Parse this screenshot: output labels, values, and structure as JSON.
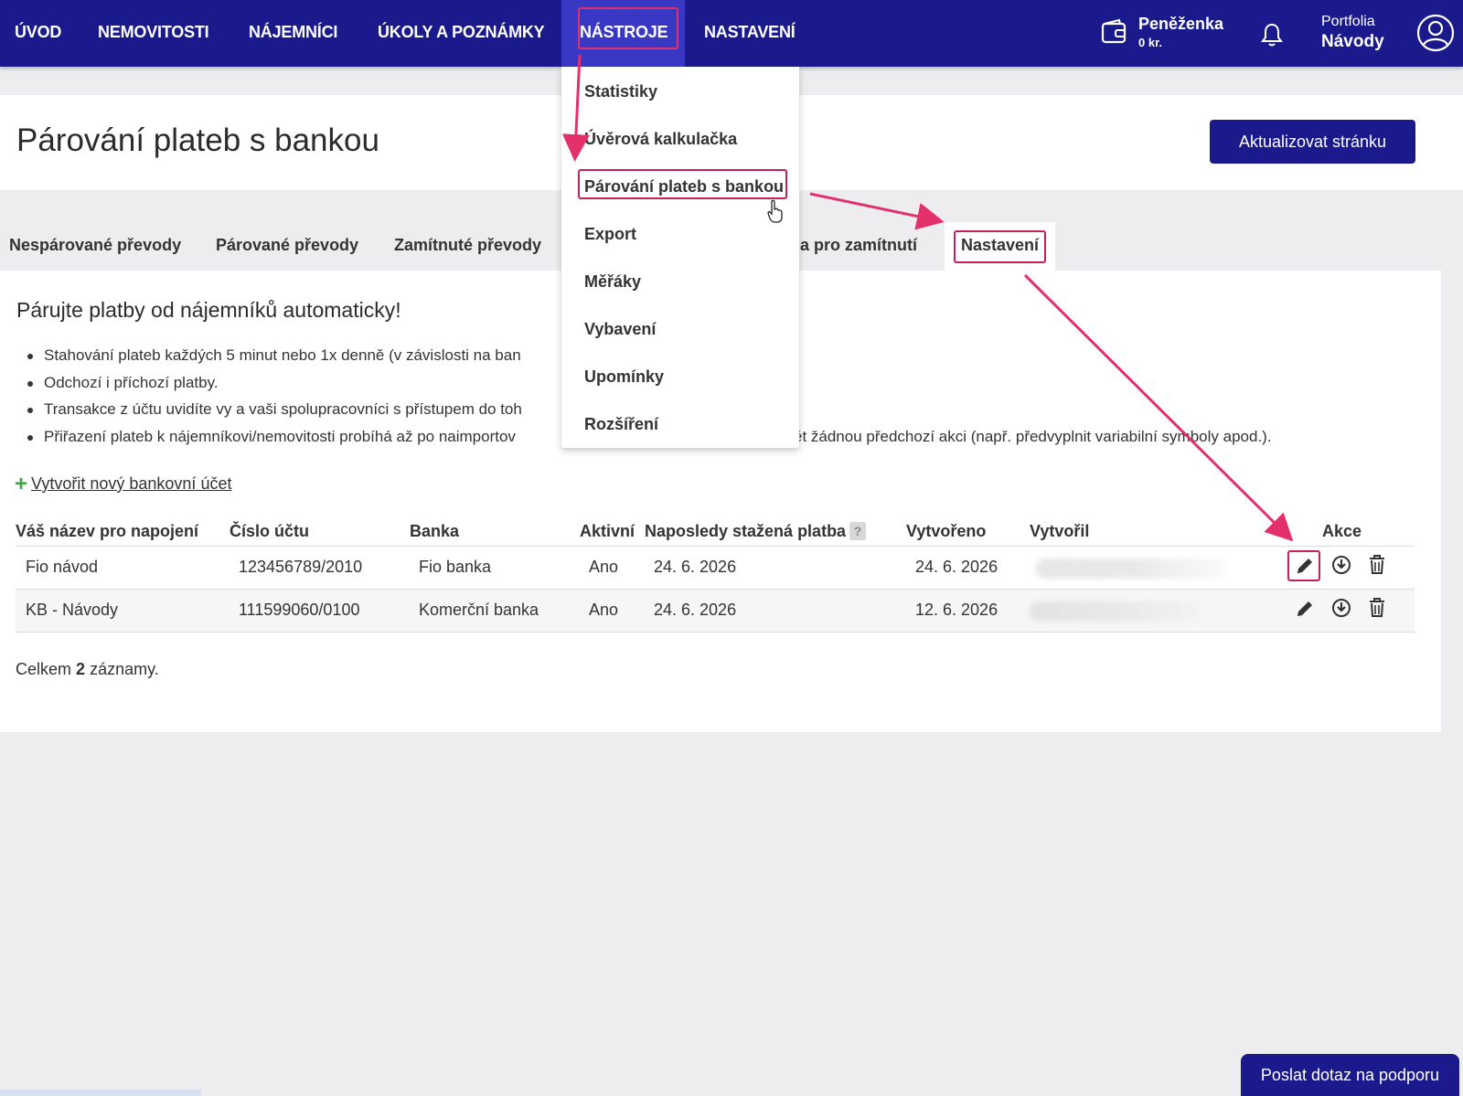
{
  "nav": {
    "items": [
      "ÚVOD",
      "NEMOVITOSTI",
      "NÁJEMNÍCI",
      "ÚKOLY A POZNÁMKY",
      "NÁSTROJE",
      "NASTAVENÍ"
    ],
    "active": "NÁSTROJE",
    "wallet": {
      "title": "Peněženka",
      "value": "0 kr.",
      "icon": "wallet-icon"
    },
    "notifications_icon": "bell-icon",
    "portfolio": {
      "label": "Portfolia",
      "value": "Návody"
    },
    "user_icon": "user-avatar-icon"
  },
  "dropdown": {
    "items": [
      "Statistiky",
      "Úvěrová kalkulačka",
      "Párování plateb s bankou",
      "Export",
      "Měřáky",
      "Vybavení",
      "Upomínky",
      "Rozšíření"
    ],
    "highlighted": "Párování plateb s bankou"
  },
  "header": {
    "title": "Párování plateb s bankou",
    "refresh_button": "Aktualizovat stránku"
  },
  "tabs": {
    "items": [
      "Nespárované převody",
      "Párované převody",
      "Zamítnuté převody",
      "la pro zamítnutí",
      "Nastavení"
    ],
    "active": "Nastavení"
  },
  "promo": {
    "title": "Párujte platby od nájemníků automaticky!",
    "bullets": [
      "Stahování plateb každých 5 minut nebo 1x denně (v závislosti na ban",
      "Odchozí i příchozí platby.",
      "Transakce z účtu uvidíte vy a vaši spolupracovníci s přístupem do toh",
      "Přiřazení plateb k nájemníkovi/nemovitosti probíhá až po naimportov"
    ],
    "bullet_tail": "ět žádnou předchozí akci (např. předvyplnit variabilní symboly apod.)."
  },
  "create_link": "Vytvořit nový bankovní účet",
  "table": {
    "headers": [
      "Váš název pro napojení",
      "Číslo účtu",
      "Banka",
      "Aktivní",
      "Naposledy stažená platba",
      "Vytvořeno",
      "Vytvořil",
      "Akce"
    ],
    "help_badge": "?",
    "rows": [
      {
        "name": "Fio návod",
        "account": "123456789/2010",
        "bank": "Fio banka",
        "active": "Ano",
        "last_payment": "24. 6. 2026",
        "created": "24. 6. 2026"
      },
      {
        "name": "KB - Návody",
        "account": "111599060/0100",
        "bank": "Komerční banka",
        "active": "Ano",
        "last_payment": "24. 6. 2026",
        "created": "12. 6. 2026"
      }
    ],
    "action_icons": [
      "edit-icon",
      "download-icon",
      "trash-icon"
    ]
  },
  "total": {
    "prefix": "Celkem",
    "count": "2",
    "suffix": "záznamy."
  },
  "support_button": "Poslat dotaz na podporu",
  "colors": {
    "primary": "#1a1a8c",
    "nav_active": "#3838c4",
    "highlight": "#c3215c",
    "plus": "#3aa548"
  }
}
